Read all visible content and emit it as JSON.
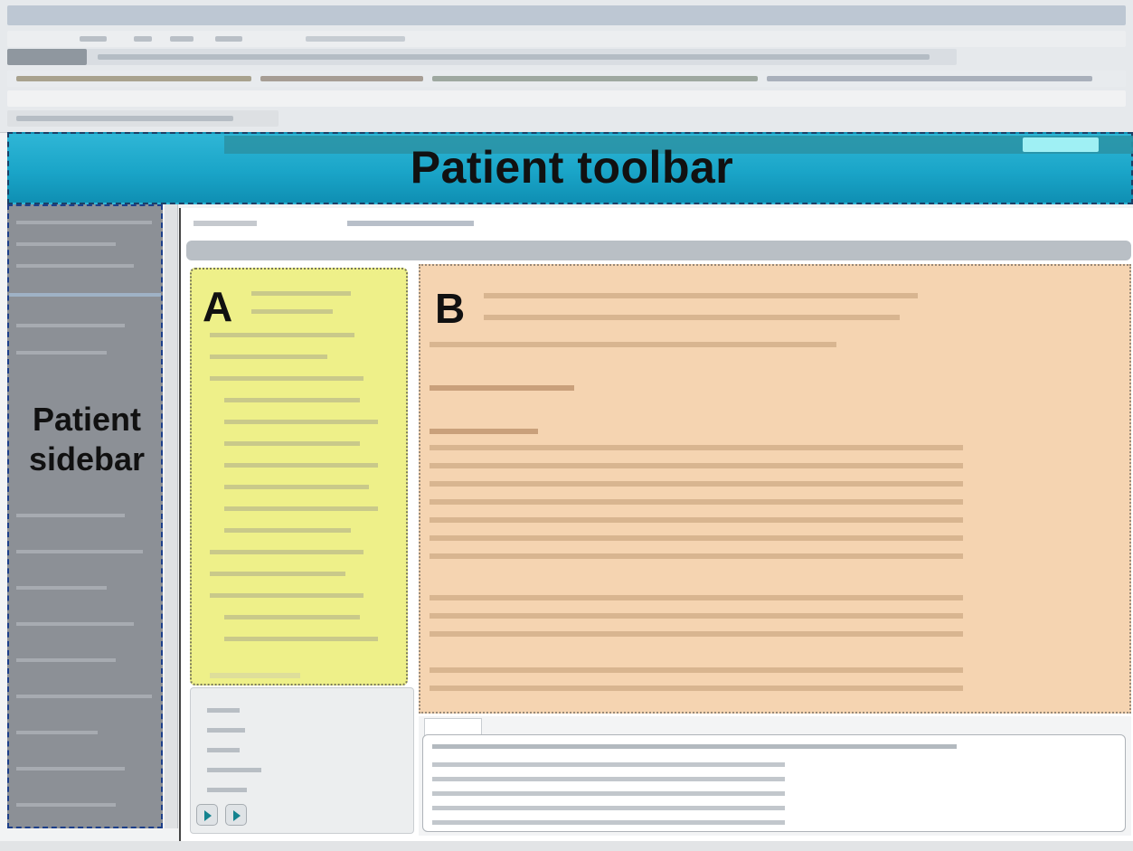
{
  "toolbar": {
    "label": "Patient toolbar"
  },
  "sidebar": {
    "label_line1": "Patient",
    "label_line2": "sidebar"
  },
  "panels": {
    "a_label": "A",
    "b_label": "B"
  },
  "colors": {
    "toolbar": "#1aa5c8",
    "sidebar": "#8c9096",
    "panel_a": "#eef089",
    "panel_b": "#f5d4b1",
    "outline": "#1d3f66"
  }
}
